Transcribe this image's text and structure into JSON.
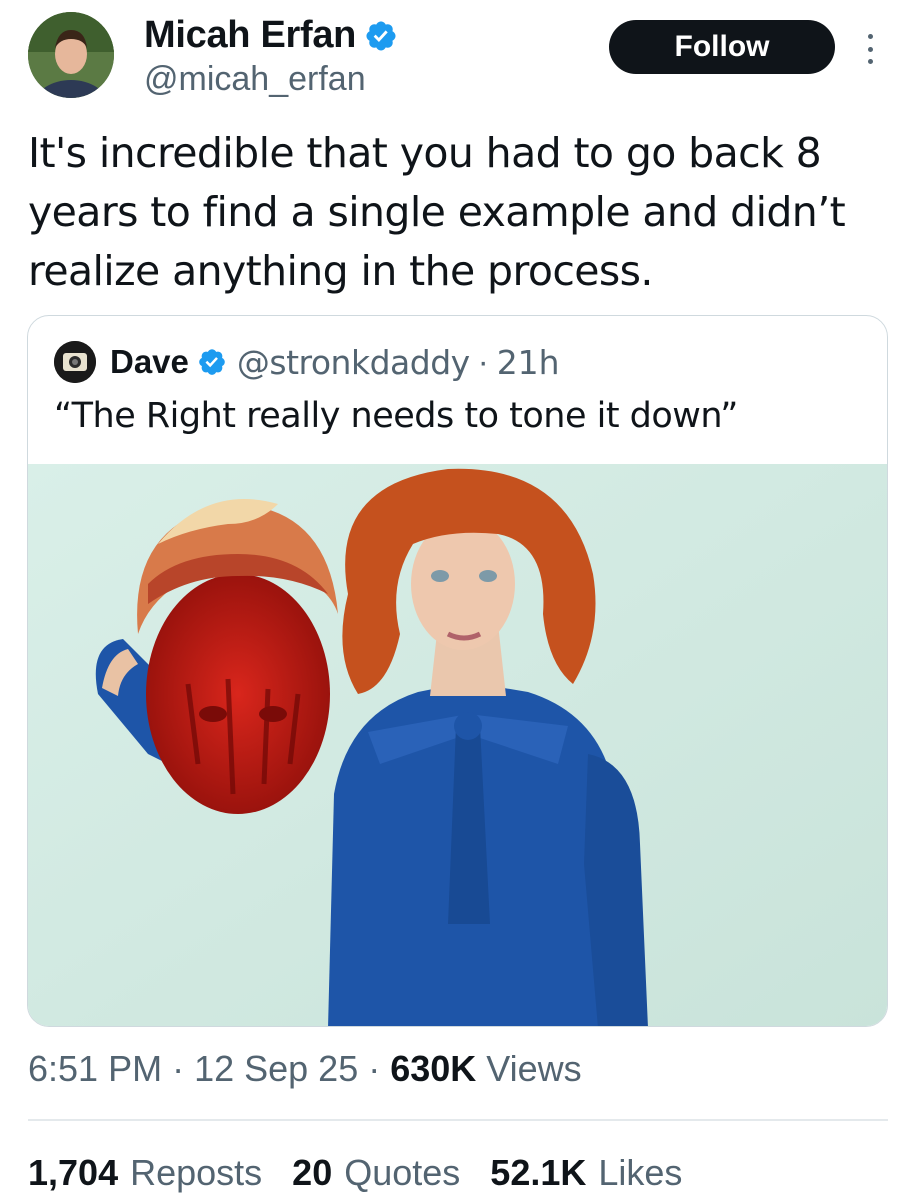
{
  "author": {
    "display_name": "Micah Erfan",
    "handle": "@micah_erfan",
    "verified_icon": "verified-badge-icon"
  },
  "follow_label": "Follow",
  "tweet": {
    "text": "It's incredible that you had to go back 8 years to find a single example and didn’t realize anything in the process."
  },
  "quoted": {
    "display_name": "Dave",
    "handle": "@stronkdaddy",
    "separator": "·",
    "time": "21h",
    "text": "“The Right really needs to tone it down”"
  },
  "meta": {
    "time": "6:51 PM",
    "sep1": "·",
    "date": "12 Sep 25",
    "sep2": "·",
    "views_count": "630K",
    "views_label": "Views"
  },
  "stats": {
    "reposts_count": "1,704",
    "reposts_label": "Reposts",
    "quotes_count": "20",
    "quotes_label": "Quotes",
    "likes_count": "52.1K",
    "likes_label": "Likes"
  },
  "colors": {
    "verified_blue": "#1d9bf0",
    "text_primary": "#0f1419",
    "text_secondary": "#536471",
    "media_background": "#d4ebe3"
  }
}
